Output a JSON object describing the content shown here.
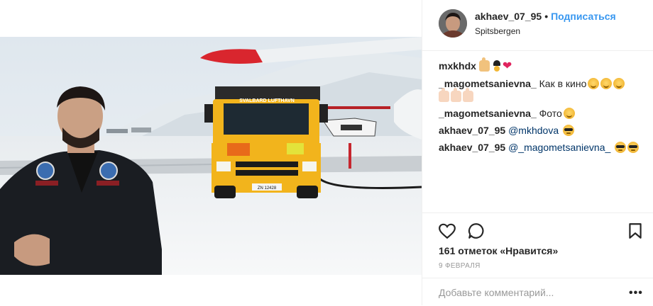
{
  "post": {
    "username": "akhaev_07_95",
    "separator": "•",
    "follow_label": "Подписаться",
    "location": "Spitsbergen",
    "photo": {
      "truck_sign": "SVALBARD LUFTHAVN",
      "plate": "ZN 12428"
    }
  },
  "comments": [
    {
      "user": "mxkhdx",
      "text": ""
    },
    {
      "user": "_magometsanievna_",
      "text": "Как в кино"
    },
    {
      "user": "_magometsanievna_",
      "text": "Фото"
    },
    {
      "user": "akhaev_07_95",
      "mention": "@mkhdova"
    },
    {
      "user": "akhaev_07_95",
      "mention": "@_magometsanievna_"
    }
  ],
  "likes_label": "161 отметок «Нравится»",
  "date_label": "9 февраля",
  "comment_input": {
    "placeholder": "Добавьте комментарий...",
    "value": ""
  },
  "more_label": "•••",
  "icons": [
    "heart-icon",
    "comment-icon",
    "bookmark-icon",
    "more-icon"
  ],
  "colors": {
    "link": "#3897f0",
    "mention": "#003569",
    "muted": "#999999",
    "truck": "#f2b41c"
  }
}
